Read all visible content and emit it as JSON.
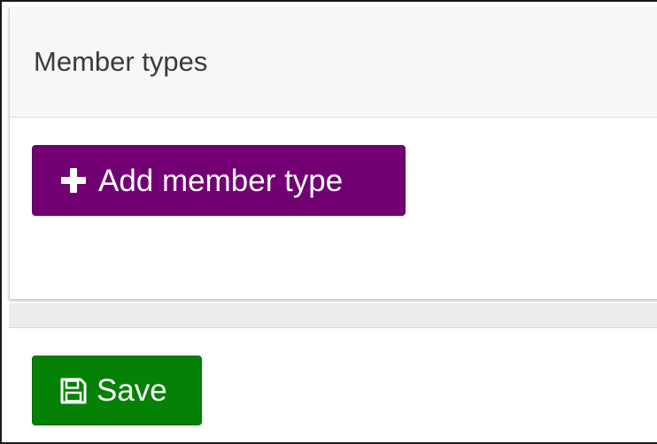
{
  "panel": {
    "title": "Member types"
  },
  "actions": {
    "add_label": "Add member type",
    "add_icon": "plus-icon",
    "save_label": "Save",
    "save_icon": "floppy-disk-icon"
  },
  "colors": {
    "add_button": "#720073",
    "save_button": "#058105"
  }
}
